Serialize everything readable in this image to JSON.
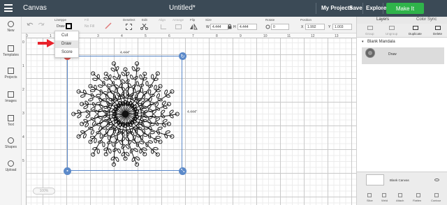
{
  "app": {
    "title": "Canvas",
    "doc_title": "Untitled*"
  },
  "topbar": {
    "my_projects": "My Projects",
    "save": "Save",
    "machine_select": "Explore",
    "make_it": "Make It"
  },
  "toolbar": {
    "linetype_label": "Linetype",
    "linetype_value": "Draw",
    "fill_label": "Fill",
    "fill_value": "No Fill",
    "deselect_label": "Deselect",
    "edit_label": "Edit",
    "align_label": "Align",
    "arrange_label": "Arrange",
    "flip_label": "Flip",
    "size_label": "Size",
    "width_label": "W",
    "width_value": "4.444",
    "height_label": "H",
    "height_value": "4.444",
    "rotate_label": "Rotate",
    "rotate_value": "0",
    "position_label": "Position",
    "x_label": "X",
    "x_value": "1.992",
    "y_label": "Y",
    "y_value": "1.003"
  },
  "linetype_menu": {
    "items": [
      "Cut",
      "Draw",
      "Score"
    ],
    "selected": "Draw"
  },
  "sidebar": {
    "items": [
      "New",
      "Templates",
      "Projects",
      "Images",
      "Text",
      "Shapes",
      "Upload"
    ]
  },
  "ruler": {
    "top": [
      "0",
      "1",
      "2",
      "3",
      "4",
      "5",
      "6",
      "7",
      "8",
      "9",
      "10",
      "11",
      "12",
      "13"
    ],
    "left": [
      "0",
      "1",
      "2",
      "3",
      "4",
      "5"
    ]
  },
  "selection": {
    "width_label": "4.444\"",
    "height_label": "4.444\""
  },
  "zoom": {
    "value": "100%"
  },
  "layers_panel": {
    "tabs": [
      "Layers",
      "Color Sync"
    ],
    "tools": [
      "Group",
      "Ungroup",
      "Duplicate",
      "Delete"
    ],
    "group_name": "Blank Mandala",
    "layer_name": "Draw",
    "blank_canvas": "Blank Canvas",
    "bottom_tools": [
      "Slice",
      "Weld",
      "Attach",
      "Flatten",
      "Contour"
    ]
  },
  "colors": {
    "topbar": "#3b4a56",
    "accent": "#2fb34a",
    "selection": "#5b89c9",
    "delete_handle": "#d9534f",
    "arrow": "#e8222b"
  }
}
